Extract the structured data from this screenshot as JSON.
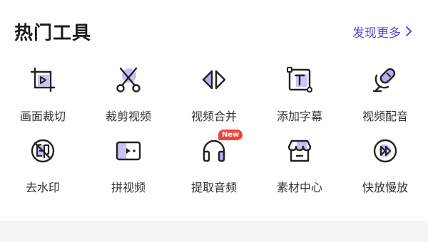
{
  "header": {
    "title": "热门工具",
    "more_label": "发现更多"
  },
  "colors": {
    "accent": "#5b4ad8",
    "icon_fill": "#b6aef5",
    "badge": "#f0443a"
  },
  "tools": [
    {
      "label": "画面裁切",
      "icon": "crop-frame-icon"
    },
    {
      "label": "裁剪视频",
      "icon": "scissors-icon"
    },
    {
      "label": "视频合并",
      "icon": "merge-arrows-icon"
    },
    {
      "label": "添加字幕",
      "icon": "text-box-icon"
    },
    {
      "label": "视频配音",
      "icon": "microphone-icon"
    },
    {
      "label": "去水印",
      "icon": "remove-watermark-icon"
    },
    {
      "label": "拼视频",
      "icon": "splice-video-icon"
    },
    {
      "label": "提取音频",
      "icon": "headphones-icon",
      "badge": "New"
    },
    {
      "label": "素材中心",
      "icon": "store-icon"
    },
    {
      "label": "快放慢放",
      "icon": "speed-icon"
    }
  ]
}
